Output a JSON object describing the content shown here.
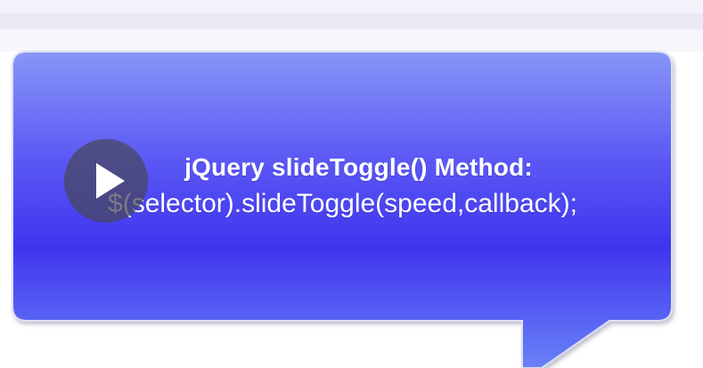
{
  "video": {
    "play_icon": "play-icon",
    "callout": {
      "title": "jQuery slideToggle() Method:",
      "code": "$(selector).slideToggle(speed,callback);"
    },
    "colors": {
      "callout_top": "#7d8bf7",
      "callout_mid": "#4a3ff0",
      "callout_bottom": "#5d74f6",
      "callout_border": "#d6d9f2",
      "text": "#ffffff"
    }
  }
}
